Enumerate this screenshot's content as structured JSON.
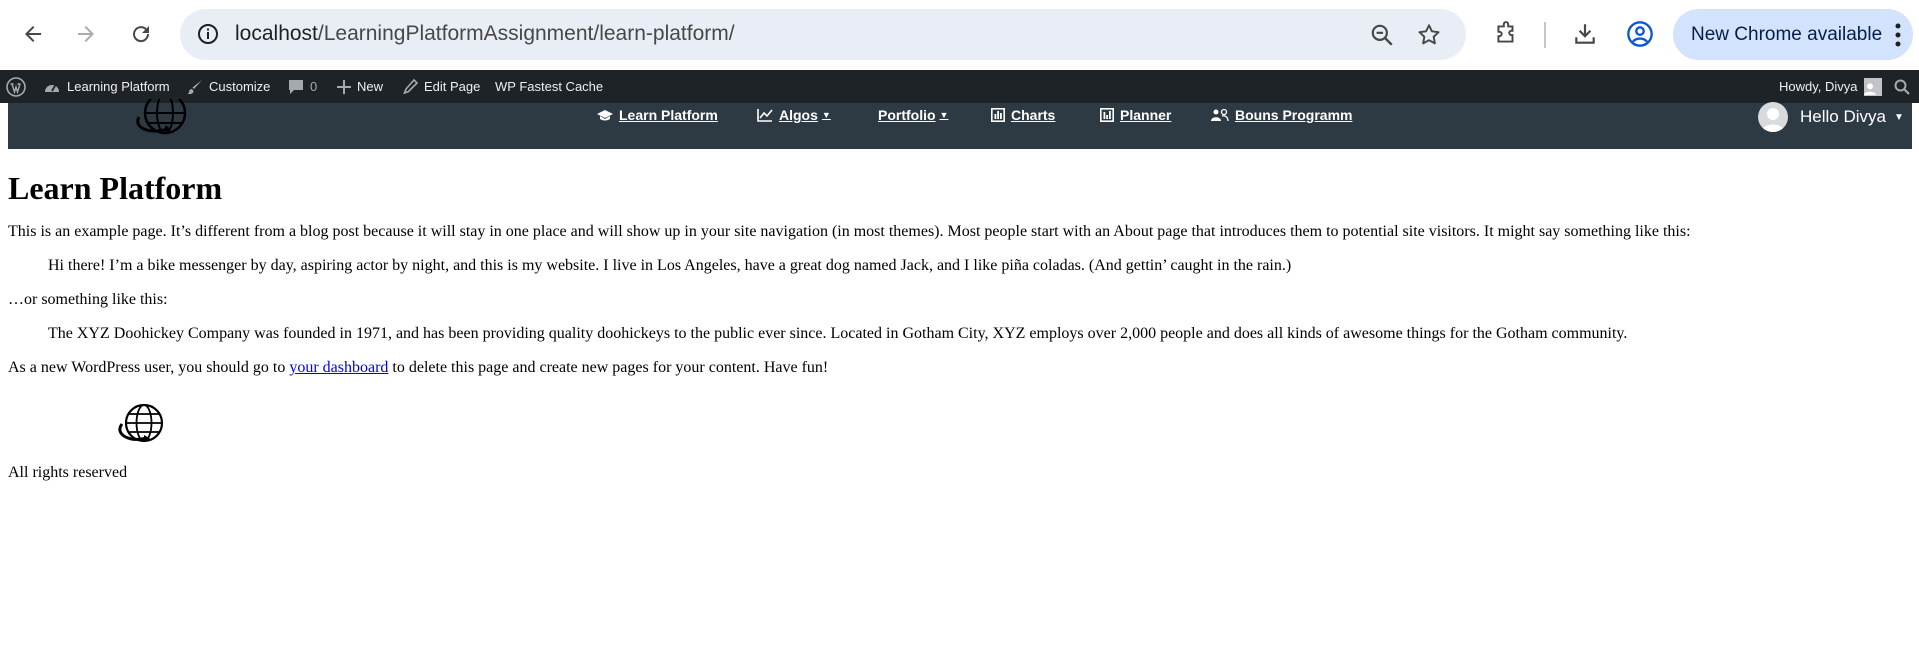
{
  "browser": {
    "url_host": "localhost",
    "url_path": "/LearningPlatformAssignment/learn-platform/",
    "update_label": "New Chrome available"
  },
  "admin_bar": {
    "site_name": "Learning Platform",
    "customize": "Customize",
    "comments_count": "0",
    "new_label": "New",
    "edit_page": "Edit Page",
    "cache_plugin": "WP Fastest Cache",
    "greeting": "Howdy, Divya"
  },
  "site_nav": {
    "items": [
      {
        "label": "Learn Platform",
        "icon": "graduation-cap-icon",
        "caret": ""
      },
      {
        "label": "Algos",
        "icon": "chart-line-icon",
        "caret": "▼"
      },
      {
        "label": "Portfolio",
        "icon": "",
        "caret": "▼"
      },
      {
        "label": "Charts",
        "icon": "bar-chart-icon",
        "caret": ""
      },
      {
        "label": "Planner",
        "icon": "planner-icon",
        "caret": ""
      },
      {
        "label": "Bouns Programm",
        "icon": "users-icon",
        "caret": ""
      }
    ],
    "user_label": "Hello Divya",
    "user_caret": "▼"
  },
  "page": {
    "title": "Learn Platform",
    "intro": "This is an example page. It’s different from a blog post because it will stay in one place and will show up in your site navigation (in most themes). Most people start with an About page that introduces them to potential site visitors. It might say something like this:",
    "quote1": "Hi there! I’m a bike messenger by day, aspiring actor by night, and this is my website. I live in Los Angeles, have a great dog named Jack, and I like piña coladas. (And gettin’ caught in the rain.)",
    "middle": "…or something like this:",
    "quote2": "The XYZ Doohickey Company was founded in 1971, and has been providing quality doohickeys to the public ever since. Located in Gotham City, XYZ employs over 2,000 people and does all kinds of awesome things for the Gotham community.",
    "outro_before": "As a new WordPress user, you should go to ",
    "outro_link": "your dashboard",
    "outro_after": " to delete this page and create new pages for your content. Have fun!"
  },
  "footer": {
    "text": "All rights reserved"
  },
  "colors": {
    "admin_bar_bg": "#1d2327",
    "site_header_bg": "#2d3a43",
    "omnibox_bg": "#e9eef6",
    "update_pill_bg": "#d3e3fd",
    "link": "#0000ee"
  }
}
